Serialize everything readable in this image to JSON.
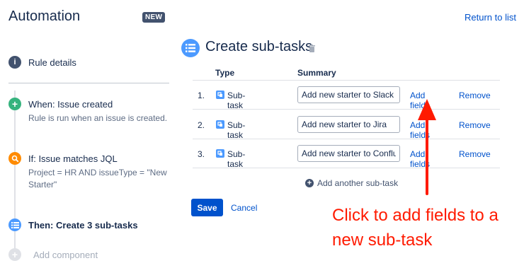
{
  "app": {
    "title": "Automation",
    "badge": "NEW",
    "return_link": "Return to list"
  },
  "sidebar": {
    "rule_details": "Rule details",
    "steps": [
      {
        "title": "When: Issue created",
        "desc": "Rule is run when an issue is created."
      },
      {
        "title": "If: Issue matches JQL",
        "desc_line1": "Project = HR AND issueType = \"New",
        "desc_line2": "Starter\""
      },
      {
        "title": "Then: Create 3 sub-tasks"
      }
    ],
    "add_component": "Add component"
  },
  "main": {
    "title": "Create sub-tasks",
    "columns": {
      "type": "Type",
      "summary": "Summary"
    },
    "rows": [
      {
        "num": "1.",
        "type": "Sub-task",
        "summary": "Add new starter to Slack",
        "add_fields": "Add fields",
        "remove": "Remove"
      },
      {
        "num": "2.",
        "type": "Sub-task",
        "summary": "Add new starter to Jira",
        "add_fields": "Add fields",
        "remove": "Remove"
      },
      {
        "num": "3.",
        "type": "Sub-task",
        "summary": "Add new starter to Confluence",
        "add_fields": "Add fields",
        "remove": "Remove"
      }
    ],
    "add_another": "Add another sub-task",
    "save": "Save",
    "cancel": "Cancel"
  },
  "annotation": {
    "text": "Click to add fields to a new sub-task",
    "color": "#ff1a00"
  },
  "colors": {
    "accent": "#0052cc",
    "success": "#36b37e",
    "warning": "#ff8b00",
    "info": "#4c9aff",
    "neutral": "#42526e"
  }
}
